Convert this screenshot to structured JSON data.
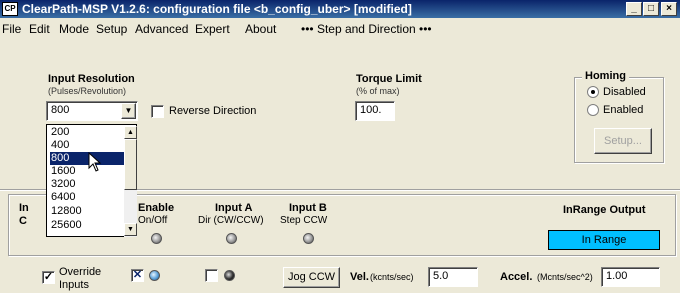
{
  "window": {
    "app_icon": "cp-logo-icon",
    "title": "ClearPath-MSP V1.2.6:  configuration file <b_config_uber> [modified]",
    "minimize": "_",
    "maximize": "□",
    "close": "×"
  },
  "menu": {
    "file": "File",
    "edit": "Edit",
    "mode": "Mode",
    "setup": "Setup",
    "advanced": "Advanced",
    "expert": "Expert",
    "about": "About",
    "mode_display": "••• Step and Direction •••"
  },
  "input_resolution": {
    "label": "Input Resolution",
    "sublabel": "(Pulses/Revolution)",
    "selected": "800",
    "options": [
      "200",
      "400",
      "800",
      "1600",
      "3200",
      "6400",
      "12800",
      "25600"
    ],
    "selected_index": 2
  },
  "reverse_direction": {
    "label": "Reverse Direction",
    "checked": false
  },
  "torque_limit": {
    "label": "Torque Limit",
    "sublabel": "(% of max)",
    "value": "100."
  },
  "homing": {
    "label": "Homing",
    "disabled_label": "Disabled",
    "enabled_label": "Enabled",
    "selected": "Disabled",
    "setup_label": "Setup..."
  },
  "inputs_panel": {
    "partial_label_1": "In",
    "partial_label_2": "C",
    "enable_label": "Enable",
    "enable_sublabel": "On/Off",
    "input_a_label": "Input A",
    "input_a_sublabel": "Dir (CW/CCW)",
    "input_b_label": "Input B",
    "input_b_sublabel": "Step CCW",
    "inrange_label": "InRange Output",
    "inrange_value": "In Range",
    "inrange_color": "#00bfff"
  },
  "bottom": {
    "override_label_1": "Override",
    "override_label_2": "Inputs",
    "override_checked": true,
    "enable_checked": true,
    "dir_checked": false,
    "check_mark": "✓",
    "x_mark": "✕",
    "jog_label": "Jog CCW",
    "vel_label": "Vel.",
    "vel_units": "(kcnts/sec)",
    "vel_value": "5.0",
    "accel_label": "Accel.",
    "accel_units": "(Mcnts/sec^2)",
    "accel_value": "1.00"
  }
}
